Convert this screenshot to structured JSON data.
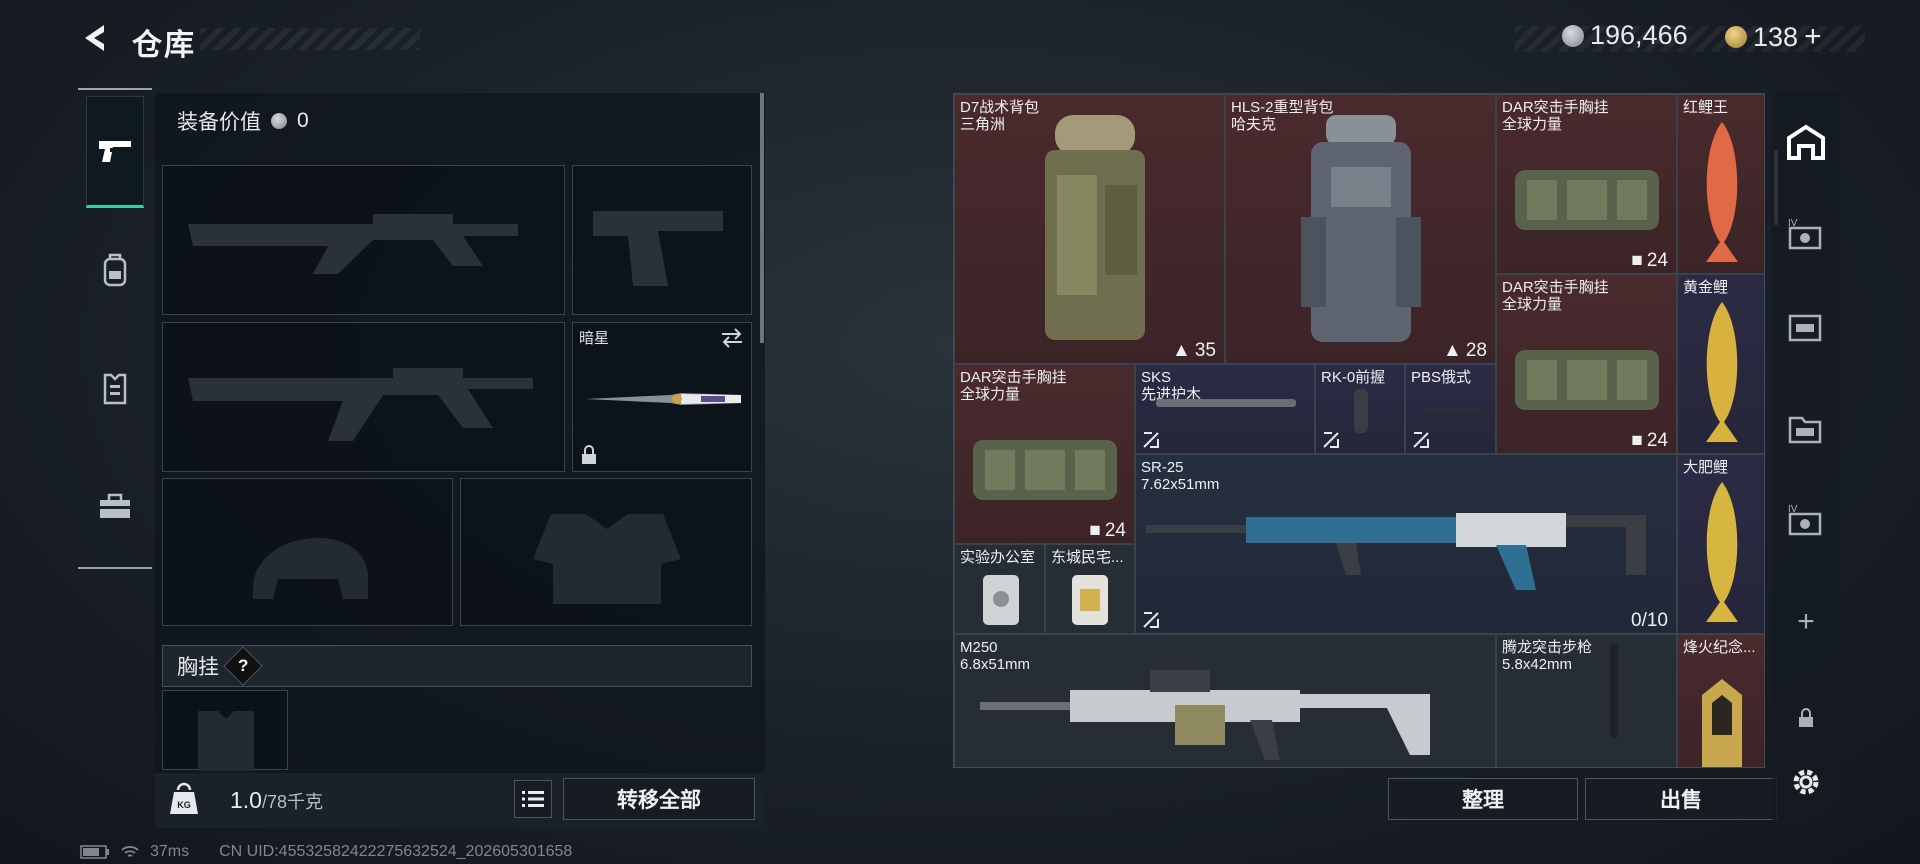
{
  "header": {
    "title": "仓库",
    "currency_silver": "196,466",
    "currency_gold": "138",
    "gold_plus": "+"
  },
  "left_nav": {
    "items": [
      "weapon-icon",
      "backpack-icon",
      "armor-icon",
      "toolbox-icon"
    ]
  },
  "equipment": {
    "value_label": "装备价值",
    "value": "0",
    "knife_name": "暗星",
    "chest_rig_label": "胸挂",
    "help_label": "?",
    "weight": "1.0",
    "weight_max": "/78千克",
    "transfer_all": "转移全部"
  },
  "storage": {
    "items": [
      {
        "name": "D7战术背包",
        "sub": "三角洲",
        "count": "35",
        "rarity": "red"
      },
      {
        "name": "HLS-2重型背包",
        "sub": "哈夫克",
        "count": "28",
        "rarity": "red"
      },
      {
        "name": "DAR突击手胸挂",
        "sub": "全球力量",
        "count": "24",
        "rarity": "red"
      },
      {
        "name": "红鲤王",
        "sub": "",
        "count": "",
        "rarity": "red"
      },
      {
        "name": "DAR突击手胸挂",
        "sub": "全球力量",
        "count": "24",
        "rarity": "red"
      },
      {
        "name": "黄金鲤",
        "sub": "",
        "count": "",
        "rarity": "purple"
      },
      {
        "name": "DAR突击手胸挂",
        "sub": "全球力量",
        "count": "24",
        "rarity": "red"
      },
      {
        "name": "SKS",
        "sub": "先进护木",
        "count": "",
        "rarity": "purple"
      },
      {
        "name": "RK-0前握",
        "sub": "",
        "count": "",
        "rarity": "purple"
      },
      {
        "name": "PBS俄式",
        "sub": "",
        "count": "",
        "rarity": "purple"
      },
      {
        "name": "SR-25",
        "sub": "7.62x51mm",
        "count": "0/10",
        "rarity": "blue"
      },
      {
        "name": "大肥鲤",
        "sub": "",
        "count": "",
        "rarity": "purple"
      },
      {
        "name": "实验办公室",
        "sub": "",
        "count": "",
        "rarity": "gray"
      },
      {
        "name": "东城民宅...",
        "sub": "",
        "count": "",
        "rarity": "gray"
      },
      {
        "name": "M250",
        "sub": "6.8x51mm",
        "count": "",
        "rarity": "gray"
      },
      {
        "name": "腾龙突击步枪",
        "sub": "5.8x42mm",
        "count": "",
        "rarity": "gray"
      },
      {
        "name": "烽火纪念...",
        "sub": "",
        "count": "",
        "rarity": "red"
      }
    ],
    "sort_button": "整理",
    "sell_button": "出售"
  },
  "right_tools": [
    "storage-home-icon",
    "storage-page-4-icon",
    "storage-page-a-icon",
    "storage-page-b-icon",
    "storage-page-4b-icon",
    "add-icon",
    "lock-icon",
    "settings-icon"
  ],
  "status_bar": {
    "ping": "37ms",
    "uid": "CN UID:455325824222756325​24_202605301658"
  },
  "colors": {
    "accent": "#2fd3b0",
    "rarity_red": "#4a2a2d",
    "rarity_purple": "#2c2b45",
    "rarity_blue": "#262f40"
  }
}
